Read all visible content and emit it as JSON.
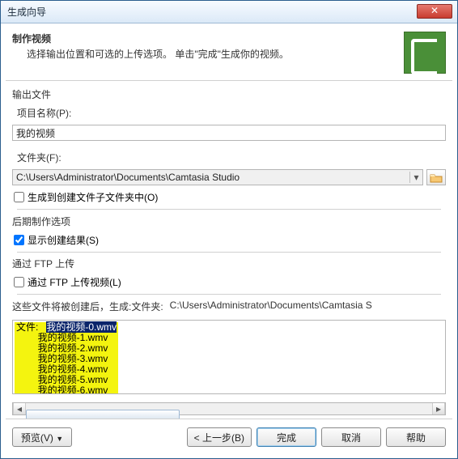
{
  "window": {
    "title": "生成向导"
  },
  "header": {
    "title": "制作视频",
    "subtitle": "选择输出位置和可选的上传选项。 单击\"完成\"生成你的视频。"
  },
  "output": {
    "section": "输出文件",
    "project_label": "项目名称(P):",
    "project_value": "我的视频",
    "folder_label": "文件夹(F):",
    "folder_value": "C:\\Users\\Administrator\\Documents\\Camtasia Studio",
    "subfolder_cb": "生成到创建文件子文件夹中(O)",
    "subfolder_checked": false
  },
  "post": {
    "section": "后期制作选项",
    "show_cb": "显示创建结果(S)",
    "show_checked": true
  },
  "ftp": {
    "section": "通过 FTP 上传",
    "upload_cb": "通过 FTP 上传视频(L)",
    "upload_checked": false
  },
  "files": {
    "label": "这些文件将被创建后，生成:文件夹:",
    "path": "C:\\Users\\Administrator\\Documents\\Camtasia S",
    "list_prefix": "文件:",
    "list": [
      "我的视频-0.wmv",
      "我的视频-1.wmv",
      "我的视频-2.wmv",
      "我的视频-3.wmv",
      "我的视频-4.wmv",
      "我的视频-5.wmv",
      "我的视频-6.wmv"
    ]
  },
  "buttons": {
    "preview": "预览(V)",
    "back": "< 上一步(B)",
    "finish": "完成",
    "cancel": "取消",
    "help": "帮助"
  },
  "icons": {
    "close": "✕",
    "dropdown": "▾",
    "left": "◂",
    "right": "▸",
    "preview_dd": "▼"
  }
}
